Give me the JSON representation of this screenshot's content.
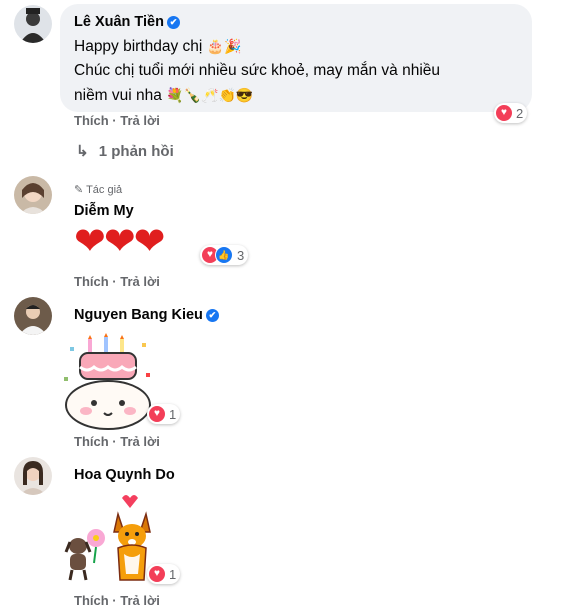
{
  "comments": [
    {
      "author": "Lê Xuân Tiền",
      "verified": true,
      "lines": [
        "Happy birthday chị",
        "Chúc chị tuổi mới nhiều sức khoẻ, may mắn và nhiều",
        "niềm vui nha"
      ],
      "line1_emoji": "🎂🎉",
      "line3_emoji": "💐🍾🥂👏😎",
      "reaction_count": "2",
      "like_label": "Thích",
      "reply_label": "Trả lời",
      "replies_label": "1 phản hồi"
    },
    {
      "author_badge": "Tác giả",
      "author": "Diễm My",
      "hearts": "❤❤❤",
      "reaction_count": "3",
      "like_label": "Thích",
      "reply_label": "Trả lời"
    },
    {
      "author": "Nguyen Bang Kieu",
      "verified": true,
      "sticker": "birthday-cake-sticker",
      "reaction_count": "1",
      "like_label": "Thích",
      "reply_label": "Trả lời"
    },
    {
      "author": "Hoa Quynh Do",
      "sticker": "dogs-with-flower-sticker",
      "reaction_count": "1",
      "like_label": "Thích",
      "reply_label": "Trả lời"
    }
  ],
  "icons": {
    "verified": "✔",
    "reply_arrow": "↳",
    "pencil": "✎",
    "heart": "♥",
    "like": "👍"
  },
  "colors": {
    "bubble": "#f0f2f5",
    "meta_text": "#65676b",
    "heart": "#f33e58",
    "verified": "#1877f2"
  }
}
